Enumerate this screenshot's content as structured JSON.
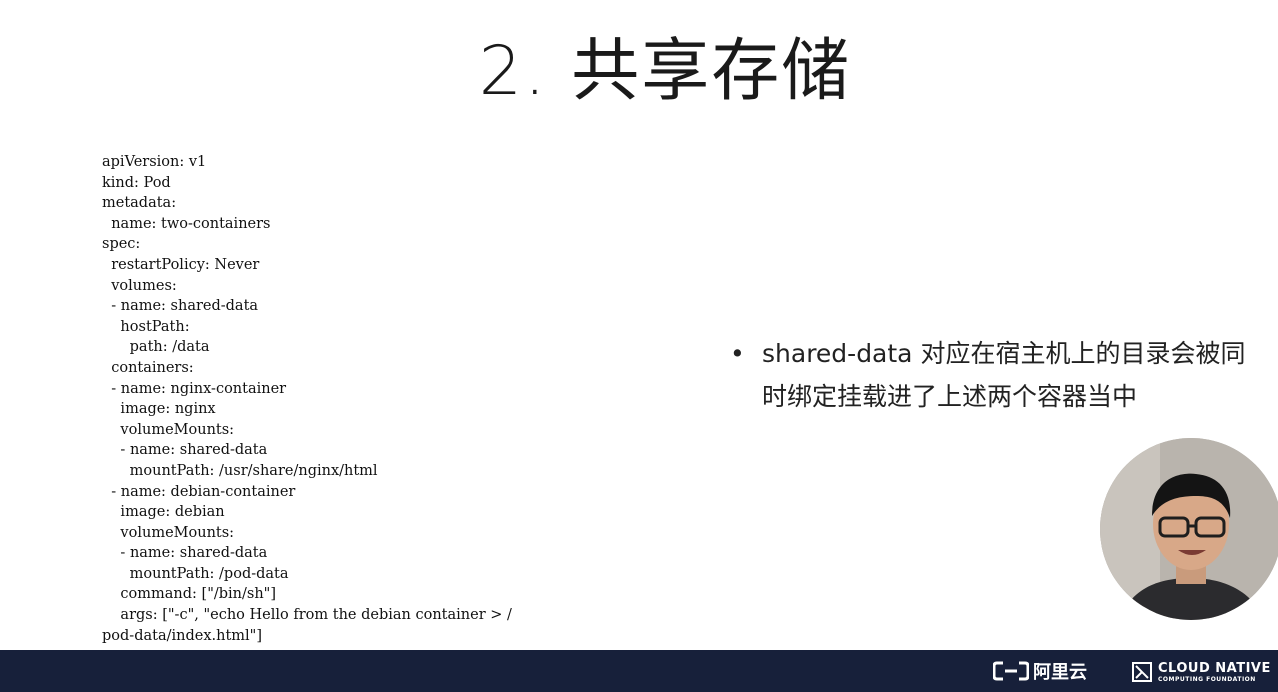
{
  "slide": {
    "title": "2. 共享存储"
  },
  "code": {
    "text": "apiVersion: v1\nkind: Pod\nmetadata:\n  name: two-containers\nspec:\n  restartPolicy: Never\n  volumes:\n  - name: shared-data\n    hostPath:\n      path: /data\n  containers:\n  - name: nginx-container\n    image: nginx\n    volumeMounts:\n    - name: shared-data\n      mountPath: /usr/share/nginx/html\n  - name: debian-container\n    image: debian\n    volumeMounts:\n    - name: shared-data\n      mountPath: /pod-data\n    command: [\"/bin/sh\"]\n    args: [\"-c\", \"echo Hello from the debian container > /\npod-data/index.html\"]"
  },
  "bullet": {
    "marker": "•",
    "text": "shared-data 对应在宿主机上的目录会被同时绑定挂载进了上述两个容器当中"
  },
  "footer": {
    "background_color": "#17203a",
    "aliyun_label": "阿里云",
    "aliyun_icon": "aliyun-bracket-icon",
    "cncf_label": "CLOUD NATIVE",
    "cncf_sublabel": "COMPUTING FOUNDATION",
    "cncf_icon": "cncf-square-icon"
  }
}
